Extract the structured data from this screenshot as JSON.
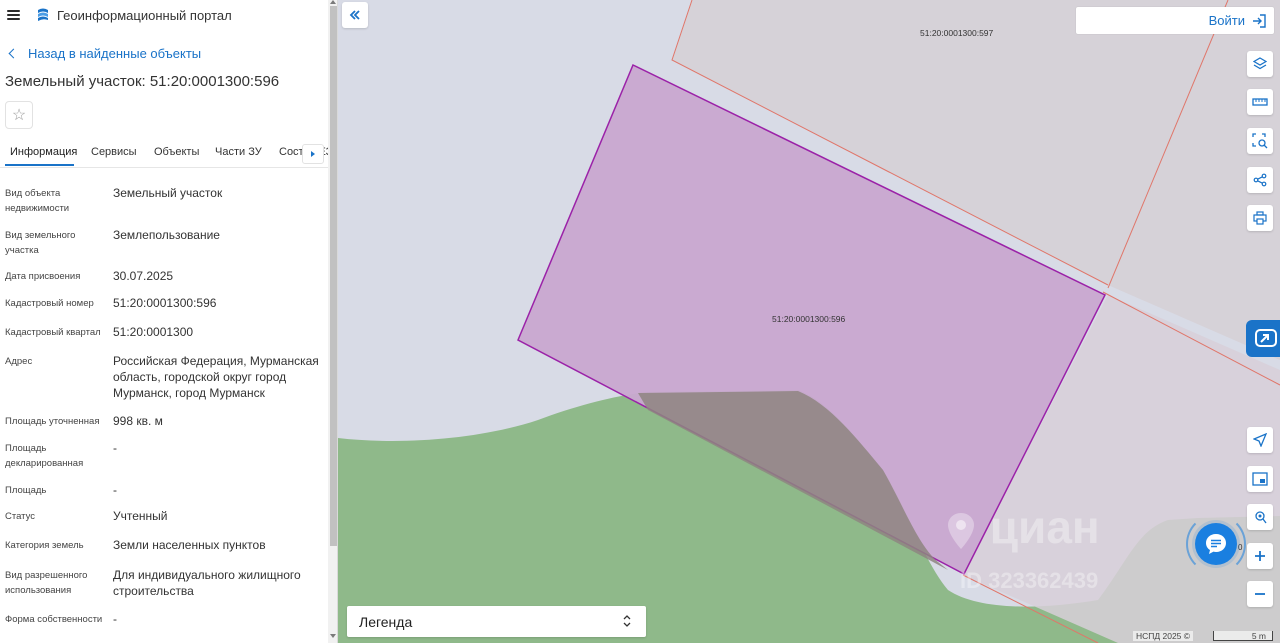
{
  "header": {
    "portal_title": "Геоинформационный портал"
  },
  "sidebar": {
    "back_label": "Назад в найденные объекты",
    "page_title": "Земельный участок: 51:20:0001300:596",
    "tabs": [
      "Информация",
      "Сервисы",
      "Объекты",
      "Части ЗУ",
      "Состав ЕЗ"
    ],
    "active_tab": "Информация",
    "properties": [
      {
        "label": "Вид объекта недвижимости",
        "value": "Земельный участок"
      },
      {
        "label": "Вид земельного участка",
        "value": "Землепользование"
      },
      {
        "label": "Дата присвоения",
        "value": "30.07.2025"
      },
      {
        "label": "Кадастровый номер",
        "value": "51:20:0001300:596"
      },
      {
        "label": "Кадастровый квартал",
        "value": "51:20:0001300"
      },
      {
        "label": "Адрес",
        "value": "Российская Федерация, Мурманская область, городской округ город Мурманск, город Мурманск"
      },
      {
        "label": "Площадь уточненная",
        "value": "998 кв. м"
      },
      {
        "label": "Площадь декларированная",
        "value": "-"
      },
      {
        "label": "Площадь",
        "value": "-"
      },
      {
        "label": "Статус",
        "value": "Учтенный"
      },
      {
        "label": "Категория земель",
        "value": "Земли населенных пунктов"
      },
      {
        "label": "Вид разрешенного использования",
        "value": "Для индивидуального жилищного строительства"
      },
      {
        "label": "Форма собственности",
        "value": "-"
      }
    ]
  },
  "map": {
    "login_label": "Войти",
    "legend_label": "Легенда",
    "parcel_labels": {
      "selected": "51:20:0001300:596",
      "neighbor": "51:20:0001300:597",
      "partial": "0"
    },
    "attribution": "НСПД 2025 ©",
    "scale_label": "5 m",
    "watermark": "циан",
    "watermark_id": "ID 323362439",
    "tools": [
      "layers-icon",
      "ruler-icon",
      "area-search-icon",
      "share-icon",
      "print-icon",
      "navigate-icon",
      "minimap-icon",
      "location-icon",
      "zoom-in-icon",
      "zoom-out-icon"
    ],
    "colors": {
      "background": "#d8dbe6",
      "vegetation": "#8fb98a",
      "selected_fill": "#c9a8d0",
      "selected_stroke": "#9b22a8",
      "neighbor_fill": "#d6d0d6",
      "boundary_line": "#e0766a",
      "accent": "#1a73c8"
    }
  }
}
